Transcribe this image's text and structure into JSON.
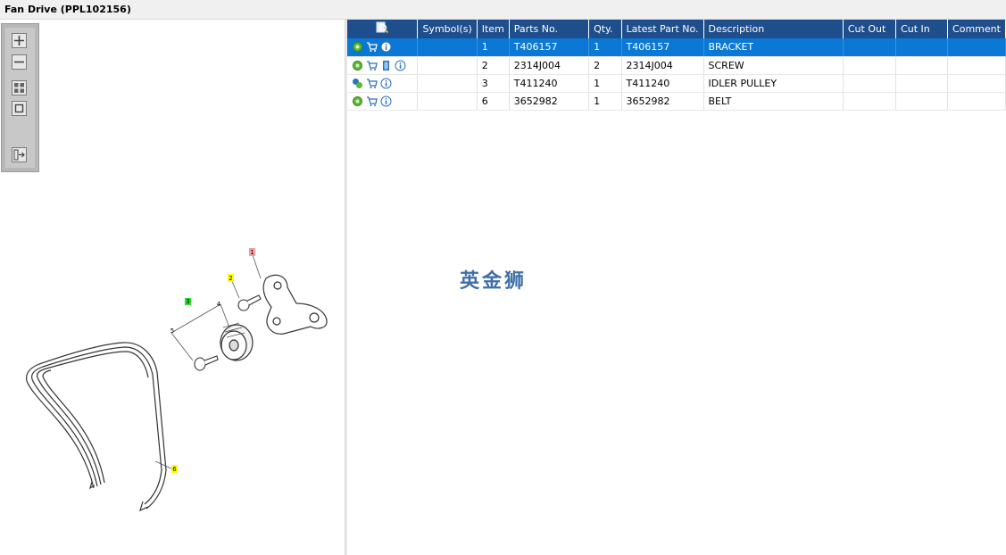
{
  "window": {
    "title": "Fan Drive (PPL102156)"
  },
  "toolbar": {
    "buttons": [
      "zoom-in",
      "zoom-out",
      "fit-all",
      "fit-window",
      "show-list"
    ]
  },
  "diagram": {
    "callouts": [
      {
        "label": "1",
        "color": "#f4a0a0"
      },
      {
        "label": "2",
        "color": "#ffff00"
      },
      {
        "label": "3",
        "color": "#33dd33"
      },
      {
        "label": "4",
        "color": ""
      },
      {
        "label": "5",
        "color": ""
      },
      {
        "label": "6",
        "color": "#ffff00"
      }
    ]
  },
  "table": {
    "columns": [
      "Symbol(s)",
      "Item",
      "Parts No.",
      "Qty.",
      "Latest Part No.",
      "Description",
      "Cut Out",
      "Cut In",
      "Comment"
    ],
    "rows": [
      {
        "item": "1",
        "part_no": "T406157",
        "qty": "1",
        "latest": "T406157",
        "desc": "BRACKET",
        "selected": true,
        "icons": [
          "gear-icon",
          "cart-icon",
          "info-icon"
        ]
      },
      {
        "item": "2",
        "part_no": "2314J004",
        "qty": "2",
        "latest": "2314J004",
        "desc": "SCREW",
        "selected": false,
        "icons": [
          "gear-icon",
          "cart-icon",
          "book-icon",
          "info-icon"
        ]
      },
      {
        "item": "3",
        "part_no": "T411240",
        "qty": "1",
        "latest": "T411240",
        "desc": "IDLER PULLEY",
        "selected": false,
        "icons": [
          "gears-icon",
          "cart-icon",
          "info-icon"
        ]
      },
      {
        "item": "6",
        "part_no": "3652982",
        "qty": "1",
        "latest": "3652982",
        "desc": "BELT",
        "selected": false,
        "icons": [
          "gear-icon",
          "cart-icon",
          "info-icon"
        ]
      }
    ]
  },
  "watermark": "英金狮",
  "colors": {
    "header": "#1f4e8c",
    "selected": "#0a78d4"
  }
}
